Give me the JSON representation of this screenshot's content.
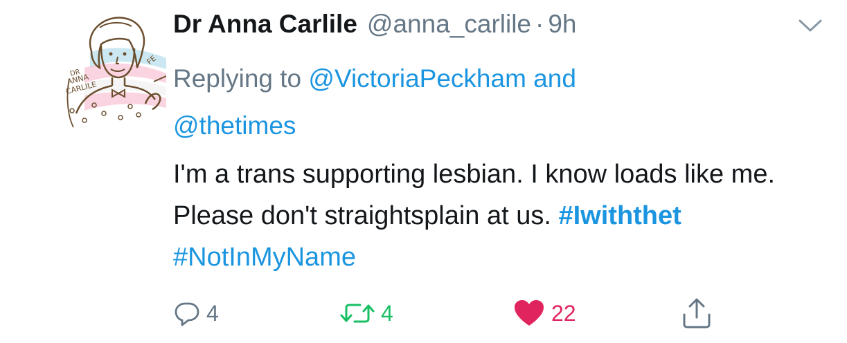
{
  "tweet": {
    "author_name": "Dr Anna Carlile",
    "handle": "@anna_carlile",
    "separator": "·",
    "time": "9h",
    "reply_prefix": "Replying to",
    "reply_user1": "@VictoriaPeckham",
    "reply_and": "and",
    "reply_user2": "@thetimes",
    "text_1": "I'm a trans supporting lesbian. I know loads like me. Please don't straightsplain at us.",
    "hashtag_1": "#Iwiththet",
    "hashtag_2": "#NotInMyName",
    "avatar_text_1": "DR",
    "avatar_text_2": "ANNA",
    "avatar_text_3": "CARLILE",
    "avatar_text_4": "FE"
  },
  "actions": {
    "reply_count": "4",
    "retweet_count": "4",
    "like_count": "22"
  },
  "colors": {
    "link": "#1b95e0",
    "muted": "#657786",
    "retweet": "#17bf63",
    "like": "#e0245e"
  },
  "icons": {
    "more": "chevron-down-icon",
    "reply": "reply-bubble-icon",
    "retweet": "retweet-icon",
    "like": "heart-icon",
    "share": "share-icon"
  }
}
